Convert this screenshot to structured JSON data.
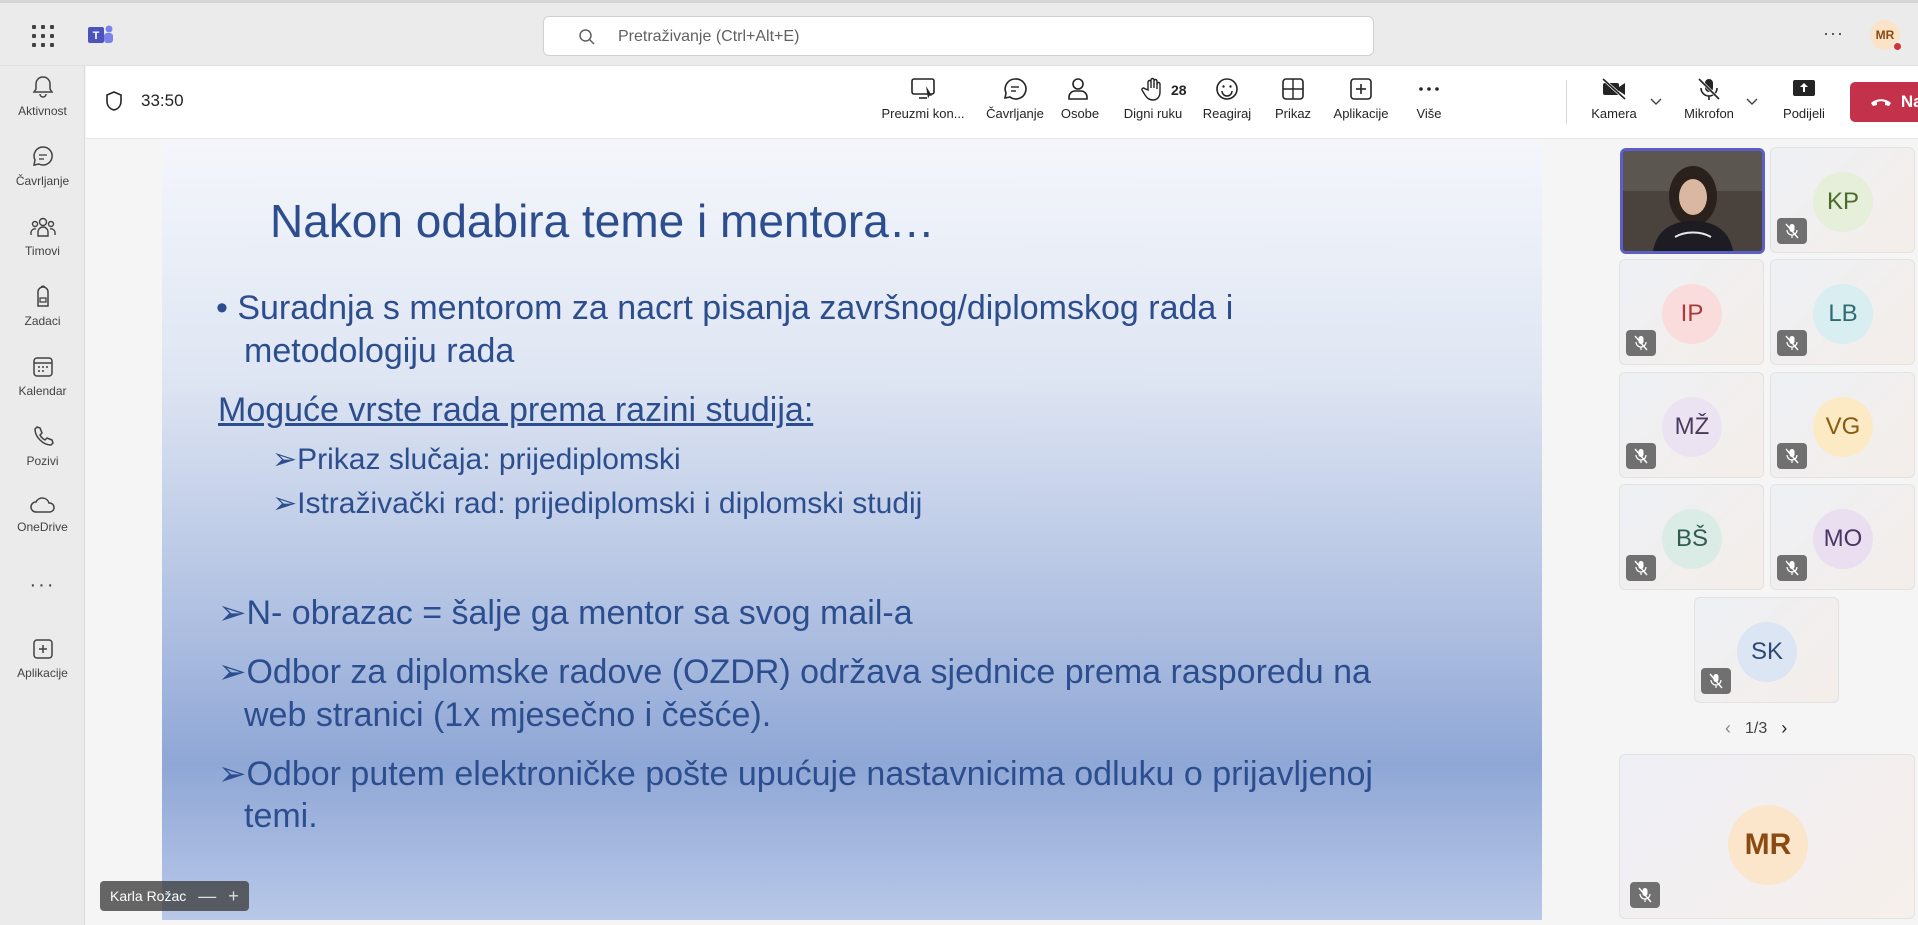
{
  "search": {
    "placeholder": "Pretraživanje (Ctrl+Alt+E)"
  },
  "user": {
    "initials": "MR"
  },
  "rail": [
    {
      "label": "Aktivnost"
    },
    {
      "label": "Čavrljanje"
    },
    {
      "label": "Timovi"
    },
    {
      "label": "Zadaci"
    },
    {
      "label": "Kalendar"
    },
    {
      "label": "Pozivi"
    },
    {
      "label": "OneDrive"
    },
    {
      "label": "Aplikacije"
    }
  ],
  "meeting": {
    "timer": "33:50",
    "people_count": "28",
    "buttons": {
      "take_control": "Preuzmi kon...",
      "chat": "Čavrljanje",
      "people": "Osobe",
      "raise_hand": "Digni ruku",
      "react": "Reagiraj",
      "view": "Prikaz",
      "apps": "Aplikacije",
      "more": "Više",
      "camera": "Kamera",
      "mic": "Mikrofon",
      "share": "Podijeli",
      "leave": "Napusti"
    }
  },
  "slide": {
    "title": "Nakon odabira teme i mentora…",
    "bullet1_line1": "• Suradnja s mentorom za nacrt pisanja završnog/diplomskog rada i",
    "bullet1_line2": "metodologiju rada",
    "heading": "Moguće vrste rada prema razini studija:",
    "sub1": "➢Prikaz slučaja: prijediplomski",
    "sub2": "➢Istraživački rad: prijediplomski i diplomski studij",
    "point1": "➢N- obrazac = šalje ga mentor sa svog mail-a",
    "point2_line1": "➢Odbor za diplomske radove (OZDR) održava sjednice prema rasporedu na",
    "point2_line2": "web stranici (1x mjesečno i češće).",
    "point3_line1": "➢Odbor putem elektroničke pošte upućuje nastavnicima odluku o prijavljenoj",
    "point3_line2": "temi.",
    "presenter": "Karla Rožac"
  },
  "participants": [
    {
      "initials": "KP",
      "bg": "#e6efd9",
      "fg": "#4b6b2a"
    },
    {
      "initials": "IP",
      "bg": "#fbdcdc",
      "fg": "#a83a3a"
    },
    {
      "initials": "LB",
      "bg": "#d8eef0",
      "fg": "#2f6b73"
    },
    {
      "initials": "MŽ",
      "bg": "#ece3f2",
      "fg": "#4a3b5a"
    },
    {
      "initials": "VG",
      "bg": "#fbeac3",
      "fg": "#8a5a10"
    },
    {
      "initials": "BŠ",
      "bg": "#dbece7",
      "fg": "#2f5b50"
    },
    {
      "initials": "MO",
      "bg": "#eadff0",
      "fg": "#4a3563"
    },
    {
      "initials": "SK",
      "bg": "#dbe5f3",
      "fg": "#2f4a73"
    }
  ],
  "pager": {
    "label": "1/3",
    "prev": "‹",
    "next": "›"
  },
  "self": {
    "initials": "MR"
  }
}
